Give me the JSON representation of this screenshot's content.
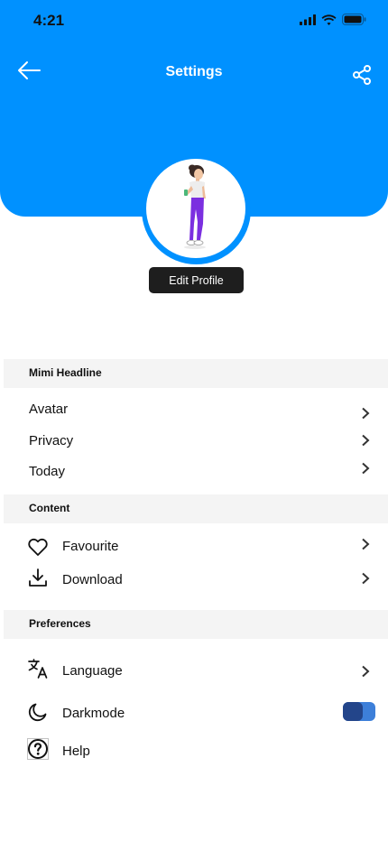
{
  "status_bar": {
    "time": "4:21"
  },
  "header": {
    "title": "Settings"
  },
  "profile": {
    "edit_label": "Edit Profile"
  },
  "sections": {
    "mimi": {
      "title": "Mimi Headline",
      "items": [
        {
          "label": "Avatar"
        },
        {
          "label": "Privacy"
        },
        {
          "label": "Today"
        }
      ]
    },
    "content": {
      "title": "Content",
      "items": [
        {
          "label": "Favourite",
          "icon": "heart-icon"
        },
        {
          "label": "Download",
          "icon": "download-icon"
        }
      ]
    },
    "preferences": {
      "title": "Preferences",
      "items": [
        {
          "label": "Language",
          "icon": "translate-icon"
        },
        {
          "label": "Darkmode",
          "icon": "moon-icon",
          "toggle": true
        },
        {
          "label": "Help",
          "icon": "help-icon"
        }
      ]
    }
  },
  "colors": {
    "primary": "#0091FF",
    "button_dark": "#1E1E1E",
    "section_bg": "#F4F4F4",
    "toggle_track": "#3D7FD9",
    "toggle_knob": "#23458A"
  }
}
